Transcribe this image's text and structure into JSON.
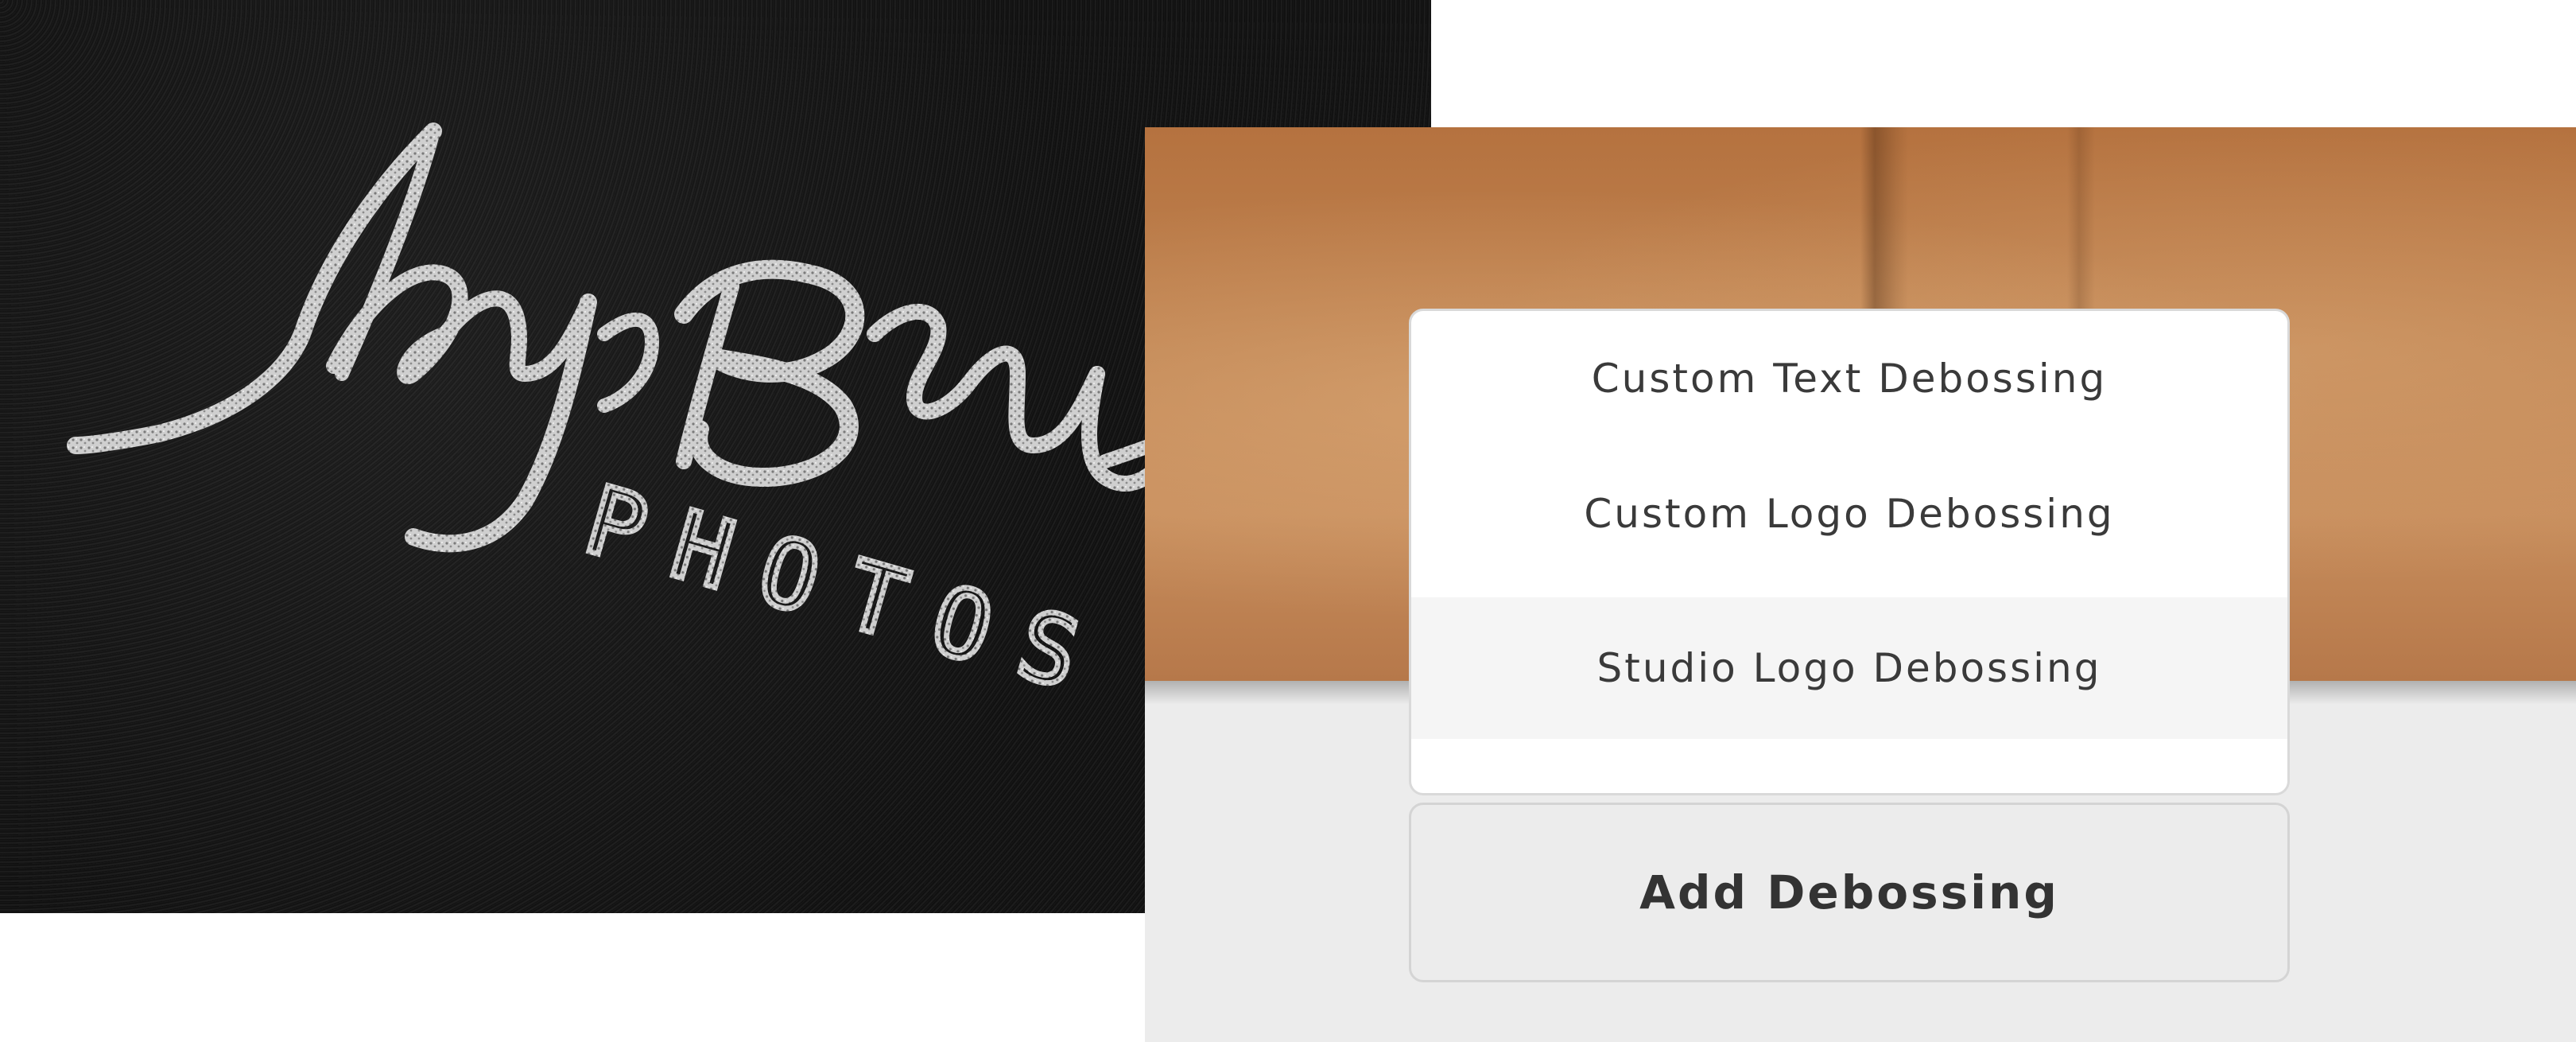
{
  "debossing_menu": {
    "options": [
      {
        "label": "Custom Text Debossing",
        "selected": false
      },
      {
        "label": "Custom Logo Debossing",
        "selected": false
      },
      {
        "label": "Studio Logo Debossing",
        "selected": true
      }
    ]
  },
  "add_button": {
    "label": "Add Debossing"
  },
  "samples": {
    "black_leather": {
      "logo_lettering": [
        "Jay Brown",
        "PHOTOS"
      ],
      "foil_color": "#d9d9d9"
    },
    "tan_leather": {
      "color": "#c08452"
    }
  },
  "colors": {
    "panel_background": "#ececec",
    "menu_text": "#3a3a3a",
    "selected_row": "#f5f5f5"
  }
}
